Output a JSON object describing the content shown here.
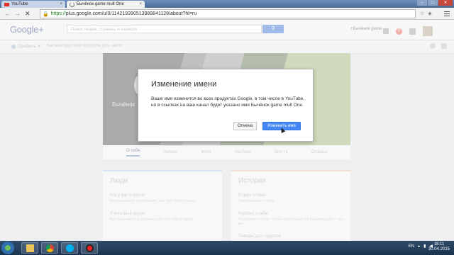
{
  "browser": {
    "tabs": [
      {
        "title": "YouTube",
        "active": false
      },
      {
        "title": "Бычёнок game mult One",
        "active": true
      }
    ],
    "url_https": "https://",
    "url_rest": "plus.google.com/u/0/114219390513989841128/about?hl=ru"
  },
  "gplus": {
    "logo": "Google+",
    "search_placeholder": "Поиск людей, страниц, и записей",
    "user_name": "+Бычёнок game",
    "notification_count": "0",
    "subnav_profile": "Профиль",
    "subnav_howlook": "Как выглядит мой профиль для",
    "subnav_howlook_value": "-никто",
    "cover_name": "Бычёнок"
  },
  "profile_tabs": [
    "О себе",
    "Записи",
    "Фото",
    "YouTube",
    "Все +1",
    "Отзывы"
  ],
  "cards": {
    "people": {
      "title": "Люди",
      "items": [
        {
          "label": "Кто у вас в кругах",
          "text": "Вы пока никого не добавили, или этот список скрыт."
        },
        {
          "label": "У кого вы в кругах",
          "text": "Вас пока никто не добавил, или этот список скрыт."
        }
      ]
    },
    "story": {
      "title": "История",
      "items": [
        {
          "label": "В двух словах",
          "text": "Самое важное о себе"
        },
        {
          "label": "Коротко о себе",
          "text": "Расскажите о себе, чтобы люди знали, что Бычёнок game – это вы"
        },
        {
          "label": "Поводы для гордости",
          "text": ""
        }
      ]
    }
  },
  "dialog": {
    "title": "Изменение имени",
    "body": "Ваше имя изменится во всех продуктах Google, в том числе в YouTube, но в ссылках на ваш канал будет указано имя Бычёнок game mult One.",
    "cancel_label": "Отмена",
    "confirm_label": "Изменить имя"
  },
  "taskbar": {
    "lang": "EN",
    "time": "18:11",
    "date": "30.04.2015"
  }
}
